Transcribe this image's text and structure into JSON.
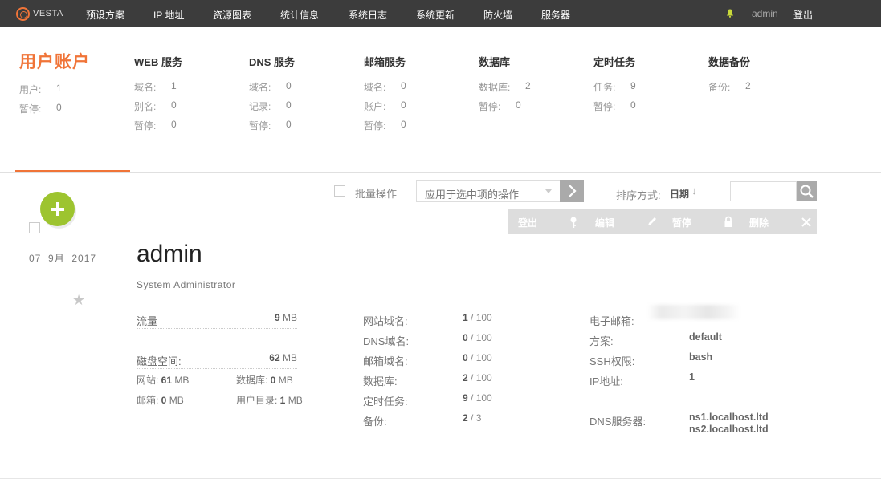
{
  "nav": {
    "logo_text": "VESTA",
    "items": [
      "预设方案",
      "IP 地址",
      "资源图表",
      "统计信息",
      "系统日志",
      "系统更新",
      "防火墙",
      "服务器"
    ],
    "user": "admin",
    "logout": "登出"
  },
  "stats": {
    "main_title": "用户账户",
    "main_rows": [
      {
        "label": "用户:",
        "value": "1"
      },
      {
        "label": "暂停:",
        "value": "0"
      }
    ],
    "columns": [
      {
        "title": "WEB 服务",
        "rows": [
          {
            "label": "域名:",
            "value": "1"
          },
          {
            "label": "别名:",
            "value": "0"
          },
          {
            "label": "暂停:",
            "value": "0"
          }
        ]
      },
      {
        "title": "DNS 服务",
        "rows": [
          {
            "label": "域名:",
            "value": "0"
          },
          {
            "label": "记录:",
            "value": "0"
          },
          {
            "label": "暂停:",
            "value": "0"
          }
        ]
      },
      {
        "title": "邮箱服务",
        "rows": [
          {
            "label": "域名:",
            "value": "0"
          },
          {
            "label": "账户:",
            "value": "0"
          },
          {
            "label": "暂停:",
            "value": "0"
          }
        ]
      },
      {
        "title": "数据库",
        "rows": [
          {
            "label": "数据库:",
            "value": "2"
          },
          {
            "label": "暂停:",
            "value": "0"
          }
        ]
      },
      {
        "title": "定时任务",
        "rows": [
          {
            "label": "任务:",
            "value": "9"
          },
          {
            "label": "暂停:",
            "value": "0"
          }
        ]
      },
      {
        "title": "数据备份",
        "rows": [
          {
            "label": "备份:",
            "value": "2"
          }
        ]
      }
    ]
  },
  "toolbar": {
    "bulk_label": "批量操作",
    "select_placeholder": "应用于选中项的操作",
    "sort_label": "排序方式:",
    "sort_value": "日期",
    "sort_arrow": "↓"
  },
  "actions": [
    {
      "label": "登出",
      "icon": "key-icon"
    },
    {
      "label": "编辑",
      "icon": "pencil-icon"
    },
    {
      "label": "暂停",
      "icon": "lock-icon"
    },
    {
      "label": "删除",
      "icon": "close-icon"
    }
  ],
  "entry": {
    "date": "07  9月  2017",
    "name": "admin",
    "description": "System Administrator",
    "star": "★",
    "traffic_label": "流量",
    "traffic_value": "9",
    "traffic_unit": " MB",
    "disk_label": "磁盘空间:",
    "disk_value": "62",
    "disk_unit": " MB",
    "sub": {
      "web_label": "网站: ",
      "web_value": "61",
      "web_unit": " MB",
      "db_label": "数据库: ",
      "db_value": "0",
      "db_unit": " MB",
      "mail_label": "邮箱: ",
      "mail_value": "0",
      "mail_unit": " MB",
      "home_label": "用户目录: ",
      "home_value": "1",
      "home_unit": " MB"
    },
    "limits": [
      {
        "label": "网站域名:",
        "used": "1",
        "max": " / 100"
      },
      {
        "label": "DNS域名:",
        "used": "0",
        "max": " / 100"
      },
      {
        "label": "邮箱域名:",
        "used": "0",
        "max": " / 100"
      },
      {
        "label": "数据库:",
        "used": "2",
        "max": " / 100"
      },
      {
        "label": "定时任务:",
        "used": "9",
        "max": " / 100"
      },
      {
        "label": "备份:",
        "used": "2",
        "max": " / 3"
      }
    ],
    "info": {
      "email_label": "电子邮箱:",
      "package_label": "方案:",
      "package_value": "default",
      "ssh_label": "SSH权限:",
      "ssh_value": "bash",
      "ip_label": "IP地址:",
      "ip_value": "1",
      "dns_label": "DNS服务器:",
      "ns1": "ns1.localhost.ltd",
      "ns2": "ns2.localhost.ltd"
    }
  },
  "colors": {
    "accent": "#f07438",
    "add_button": "#9dc42f",
    "nav_bg": "#3c3c3c"
  }
}
